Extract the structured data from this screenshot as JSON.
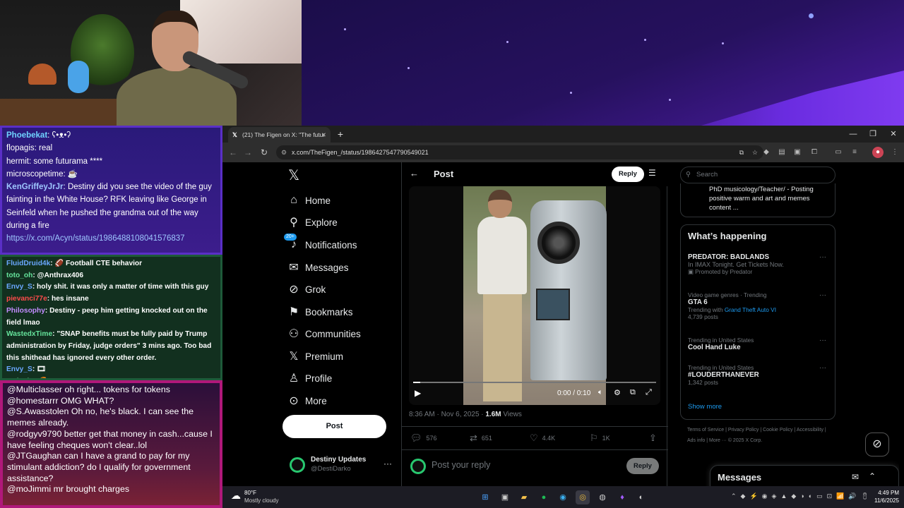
{
  "chat_top": [
    {
      "user": "Phoebekat",
      "text": ""
    },
    {
      "user": "",
      "text": "flopagis: real"
    },
    {
      "user": "",
      "text": "hermit: some futurama ****"
    },
    {
      "user": "",
      "text": "microscopetime:"
    },
    {
      "user": "KenGriffeyJrJr",
      "text": "Destiny did you see the video of the guy fainting in the White House? RFK leaving like George in Seinfeld when he pushed the grandma out of the way during a fire"
    },
    {
      "user": "",
      "text": "https://x.com/Acyn/status/1986488108041576837"
    }
  ],
  "chat_mid": [
    {
      "user": "FluidDruid4k",
      "text": "Football CTE behavior",
      "color": "#6aa7ff"
    },
    {
      "user": "toto_oh",
      "text": "@Anthrax406",
      "color": "#65e39b"
    },
    {
      "user": "Envy_S",
      "text": "holy shit. it was only a matter of time with this guy",
      "color": "#6aa7ff"
    },
    {
      "user": "pievanci77e",
      "text": "hes insane",
      "color": "#ff4b4b"
    },
    {
      "user": "Philosophy",
      "text": "Destiny - peep him getting knocked out on the field lmao",
      "color": "#c28cff"
    },
    {
      "user": "WastedxTime",
      "text": "\"SNAP benefits must be fully paid by Trump administration by Friday, judge orders\" 3 mins ago. Too bad this shithead has ignored every other order.",
      "color": "#65e39b"
    },
    {
      "user": "Envy_S",
      "text": "",
      "color": "#6aa7ff"
    },
    {
      "user": "makedo",
      "text": "",
      "color": "#65e39b"
    }
  ],
  "chat_bottom": [
    {
      "user": "@Multiclasser",
      "text": "oh right... tokens for tokens"
    },
    {
      "user": "@homestarrr",
      "text": "OMG WHAT?"
    },
    {
      "user": "@S.Awasstolen",
      "text": "Oh no, he's black. I can see the memes already."
    },
    {
      "user": "@rodgyv9790",
      "text": "better get that money in cash...cause I have feeling cheques won't clear..lol"
    },
    {
      "user": "@JTGaughan",
      "text": "can I have a grand to pay for my stimulant addiction? do I qualify for government assistance?"
    },
    {
      "user": "@moJimmi",
      "text": "mr brought charges"
    }
  ],
  "browser": {
    "tab_title": "(21) The Figen on X: \"The futur",
    "url": "x.com/TheFigen_/status/1986427547790549021"
  },
  "x": {
    "nav": [
      {
        "label": "Home",
        "icon": "home-icon",
        "glyph": "⌂"
      },
      {
        "label": "Explore",
        "icon": "search-icon",
        "glyph": "⚲"
      },
      {
        "label": "Notifications",
        "icon": "bell-icon",
        "glyph": "🔔︎"
      },
      {
        "label": "Messages",
        "icon": "mail-icon",
        "glyph": "✉"
      },
      {
        "label": "Grok",
        "icon": "grok-icon",
        "glyph": "⊘"
      },
      {
        "label": "Bookmarks",
        "icon": "bookmark-icon",
        "glyph": "⚑"
      },
      {
        "label": "Communities",
        "icon": "communities-icon",
        "glyph": "⚇"
      },
      {
        "label": "Premium",
        "icon": "x-logo-icon",
        "glyph": "𝕏"
      },
      {
        "label": "Profile",
        "icon": "person-icon",
        "glyph": "⚲"
      },
      {
        "label": "More",
        "icon": "more-icon",
        "glyph": "⋯"
      }
    ],
    "notif_badge": "20+",
    "post_button": "Post",
    "profile_name": "Destiny Updates",
    "profile_handle": "@DestiDarko",
    "header_title": "Post",
    "header_reply": "Reply",
    "video_time": "0:00 / 0:10",
    "video_progress": 0.03,
    "post_time": "8:36 AM · Nov 6, 2025 · ",
    "views_count": "1.6M",
    "views_label": " Views",
    "replies": "576",
    "reposts": "651",
    "likes": "4.4K",
    "bookmarks": "1K",
    "reply_placeholder": "Post your reply",
    "reply_button": "Reply",
    "search_placeholder": "Search",
    "bio": "PhD musicology/Teacher/ - Posting positive warm and art and memes content ...",
    "happening_title": "What’s happening",
    "trends": [
      {
        "top": "",
        "name": "PREDATOR: BADLANDS",
        "line1": "In IMAX Tonight. Get Tickets Now.",
        "line2": "Promoted by Predator"
      },
      {
        "top": "Video game genres · Trending",
        "name": "GTA 6",
        "line1": "Trending with Grand Theft Auto VI",
        "line2": "4,739 posts"
      },
      {
        "top": "Trending in United States",
        "name": "Cool Hand Luke",
        "line1": "",
        "line2": ""
      },
      {
        "top": "Trending in United States",
        "name": "#LOUDERTHANEVER",
        "line1": "1,342 posts",
        "line2": ""
      }
    ],
    "show_more": "Show more",
    "footer": "Terms of Service  |  Privacy Policy  |  Cookie Policy  |  Accessibility  |  Ads info  |  More ···  © 2025 X Corp.",
    "messages_label": "Messages"
  },
  "taskbar": {
    "weather_temp": "80°F",
    "weather_desc": "Mostly cloudy",
    "time": "4:49 PM",
    "date": "11/6/2025"
  },
  "colors": {
    "accent": "#1d9bf0",
    "x_bg": "#000000",
    "chat_top_bg": "#2a1a7a",
    "chat_mid_bg": "#12301f",
    "chat_bottom_border": "#b0187a"
  }
}
